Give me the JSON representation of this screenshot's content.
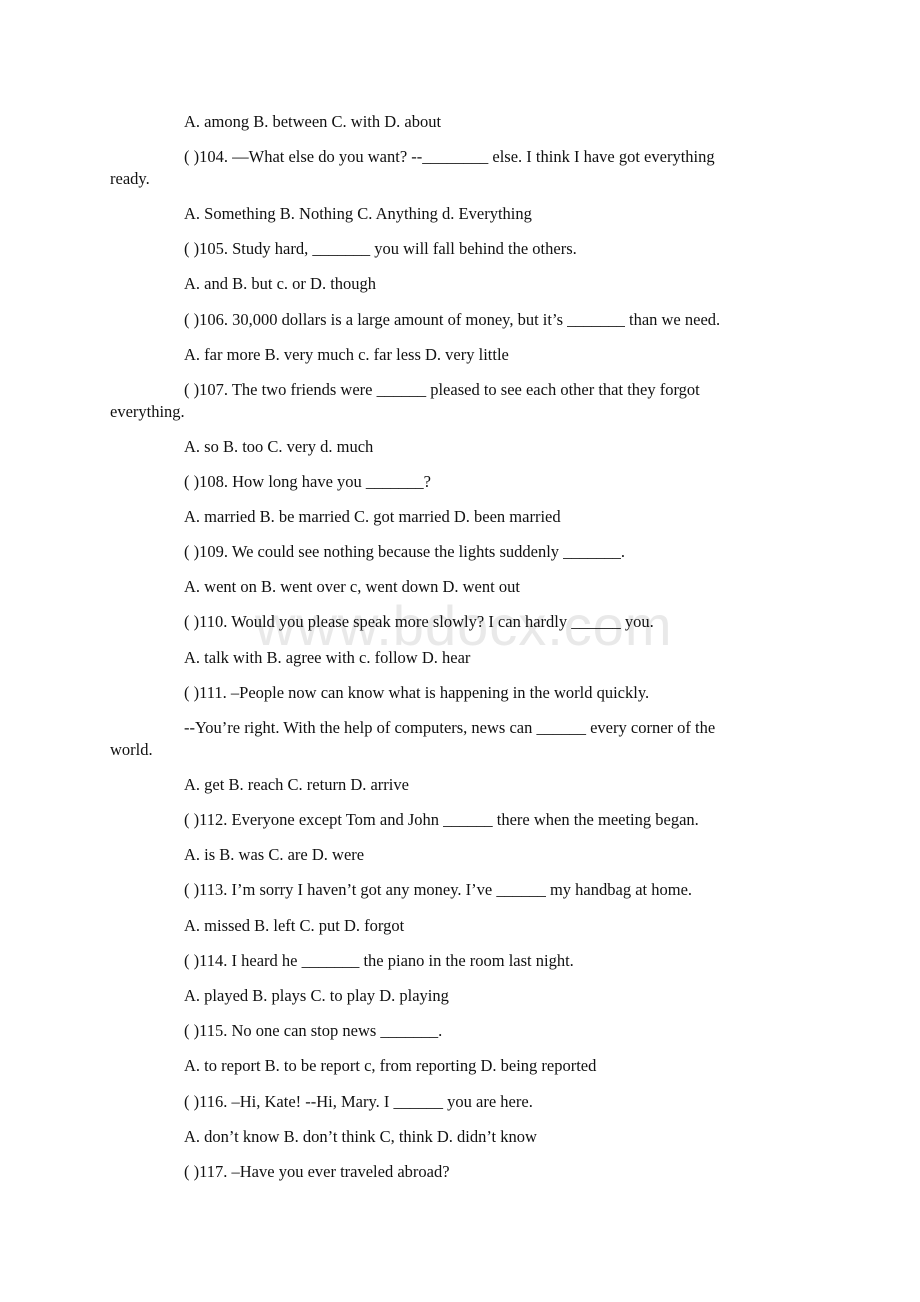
{
  "watermark": "www.bdocx.com",
  "lines": [
    {
      "text": "A. among B. between C. with D. about",
      "type": "options"
    },
    {
      "text": "( )104. —What else do you want? --________ else. I think I have got everything",
      "type": "question"
    },
    {
      "text": "ready.",
      "type": "continuation"
    },
    {
      "text": "A. Something B. Nothing C. Anything d. Everything",
      "type": "options"
    },
    {
      "text": "( )105. Study hard, _______ you will fall behind the others.",
      "type": "question"
    },
    {
      "text": "A. and B. but c. or D. though",
      "type": "options"
    },
    {
      "text": "( )106. 30,000 dollars is a large amount of money, but it’s _______ than we need.",
      "type": "question"
    },
    {
      "text": "A. far more B. very much c. far less D. very little",
      "type": "options"
    },
    {
      "text": "( )107. The two friends were ______ pleased to see each other that they forgot",
      "type": "question"
    },
    {
      "text": "everything.",
      "type": "continuation"
    },
    {
      "text": "A. so B. too C. very d. much",
      "type": "options"
    },
    {
      "text": "( )108. How long have you _______?",
      "type": "question"
    },
    {
      "text": "A. married B. be married C. got married D. been married",
      "type": "options"
    },
    {
      "text": "( )109. We could see nothing because the lights suddenly _______.",
      "type": "question"
    },
    {
      "text": "A. went on B. went over c, went down D. went out",
      "type": "options"
    },
    {
      "text": "( )110. Would you please speak more slowly? I can hardly ______ you.",
      "type": "question"
    },
    {
      "text": "A. talk with B. agree with c. follow D. hear",
      "type": "options"
    },
    {
      "text": "( )111. –People now can know what is happening in the world quickly.",
      "type": "question"
    },
    {
      "text": "--You’re right. With the help of computers, news can ______ every corner of the",
      "type": "question"
    },
    {
      "text": "world.",
      "type": "continuation"
    },
    {
      "text": "A. get B. reach C. return D. arrive",
      "type": "options"
    },
    {
      "text": "( )112. Everyone except Tom and John ______ there when the meeting began.",
      "type": "question"
    },
    {
      "text": "A. is B. was C. are D. were",
      "type": "options"
    },
    {
      "text": "( )113. I’m sorry I haven’t got any money. I’ve ______ my handbag at home.",
      "type": "question"
    },
    {
      "text": "A. missed B. left C. put D. forgot",
      "type": "options"
    },
    {
      "text": "( )114. I heard he _______ the piano in the room last night.",
      "type": "question"
    },
    {
      "text": "A. played B. plays C. to play D. playing",
      "type": "options"
    },
    {
      "text": "( )115. No one can stop news _______.",
      "type": "question"
    },
    {
      "text": "A. to report B. to be report c, from reporting D. being reported",
      "type": "options"
    },
    {
      "text": "( )116. –Hi, Kate! --Hi, Mary. I ______ you are here.",
      "type": "question"
    },
    {
      "text": "A. don’t know B. don’t think C, think D. didn’t know",
      "type": "options"
    },
    {
      "text": "( )117. –Have you ever traveled abroad?",
      "type": "question"
    }
  ]
}
